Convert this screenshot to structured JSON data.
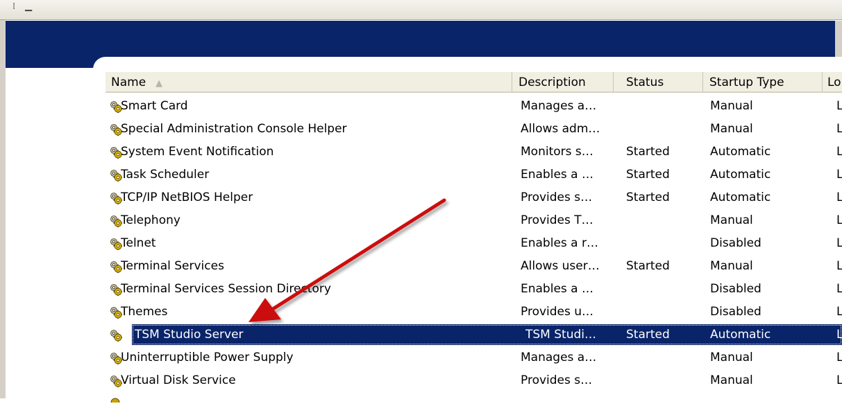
{
  "header": {
    "columns": [
      "Name",
      "Description",
      "Status",
      "Startup Type",
      "Lo"
    ],
    "sort_indicator": "▲"
  },
  "services": [
    {
      "name": "Smart Card",
      "description": "Manages a…",
      "status": "",
      "startup": "Manual",
      "logon": "Lo"
    },
    {
      "name": "Special Administration Console Helper",
      "description": "Allows adm…",
      "status": "",
      "startup": "Manual",
      "logon": "Lo"
    },
    {
      "name": "System Event Notification",
      "description": "Monitors s…",
      "status": "Started",
      "startup": "Automatic",
      "logon": "Lo"
    },
    {
      "name": "Task Scheduler",
      "description": "Enables a …",
      "status": "Started",
      "startup": "Automatic",
      "logon": "Lo"
    },
    {
      "name": "TCP/IP NetBIOS Helper",
      "description": "Provides s…",
      "status": "Started",
      "startup": "Automatic",
      "logon": "Lo"
    },
    {
      "name": "Telephony",
      "description": "Provides T…",
      "status": "",
      "startup": "Manual",
      "logon": "Lo"
    },
    {
      "name": "Telnet",
      "description": "Enables a r…",
      "status": "",
      "startup": "Disabled",
      "logon": "Lo"
    },
    {
      "name": "Terminal Services",
      "description": "Allows user…",
      "status": "Started",
      "startup": "Manual",
      "logon": "Lo"
    },
    {
      "name": "Terminal Services Session Directory",
      "description": "Enables a …",
      "status": "",
      "startup": "Disabled",
      "logon": "Lo"
    },
    {
      "name": "Themes",
      "description": "Provides u…",
      "status": "",
      "startup": "Disabled",
      "logon": "Lo"
    },
    {
      "name": "TSM Studio Server",
      "description": "TSM Studi…",
      "status": "Started",
      "startup": "Automatic",
      "logon": "Lo",
      "selected": true
    },
    {
      "name": "Uninterruptible Power Supply",
      "description": "Manages a…",
      "status": "",
      "startup": "Manual",
      "logon": "Lo"
    },
    {
      "name": "Virtual Disk Service",
      "description": "Provides s…",
      "status": "",
      "startup": "Manual",
      "logon": "Lo"
    }
  ],
  "icons": {
    "service": "gears-icon",
    "annotation": "red-arrow"
  },
  "colors": {
    "selection": "#0a246a",
    "banner": "#0a246a",
    "arrow": "#cc1111",
    "gear": "#c8a000"
  }
}
